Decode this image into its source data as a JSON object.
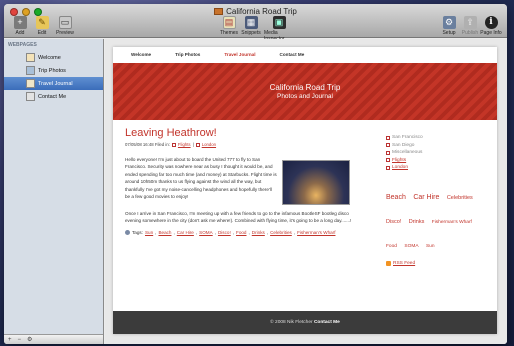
{
  "window": {
    "title": "California Road Trip"
  },
  "toolbar": {
    "left": [
      {
        "label": "Add"
      },
      {
        "label": "Edit"
      },
      {
        "label": "Preview"
      }
    ],
    "center": [
      {
        "label": "Themes"
      },
      {
        "label": "Snippets"
      },
      {
        "label": "Media Inspector"
      }
    ],
    "right": [
      {
        "label": "Setup"
      },
      {
        "label": "Publish"
      },
      {
        "label": "Page Info"
      }
    ]
  },
  "sidebar": {
    "heading": "WEBPAGES",
    "items": [
      {
        "label": "Welcome"
      },
      {
        "label": "Trip Photos"
      },
      {
        "label": "Travel Journal"
      },
      {
        "label": "Contact Me"
      }
    ]
  },
  "site": {
    "nav": [
      "Welcome",
      "Trip Photos",
      "Travel Journal",
      "Contact Me"
    ],
    "banner_title": "California Road Trip",
    "banner_subtitle": "Photos and Journal",
    "post_title": "Leaving Heathrow!",
    "post_date": "07/05/08 16:48 Filed in:",
    "post_filed": [
      "Flights",
      "London"
    ],
    "paragraph1": "Hello everyone! I'm just about to board the United 777 to fly to San Francisco. Security was nowhere near as busy I thought it would be, and ended spending far too much time (and money) at Starbucks. Flight time is around 10h50m thanks to us flying against the wind all the way, but thankfully I've got my noise-cancelling headphones and hopefully there'll be a few good movies to enjoy!",
    "paragraph2": "Once I arrive in San Francisco, I'm meeting up with a few friends to go to the infamous BootleSF bootleg disco evening somewhere in the city (don't ask me where!). Combined with flying time, it's going to be a long day.......!",
    "tags_label": "Tags:",
    "tags": [
      "Sun",
      "Beach",
      "Car Hire",
      "SOMA",
      "Disco!",
      "Food",
      "Drinks",
      "Celebrities",
      "Fisherman's Wharf"
    ],
    "side_links": [
      {
        "label": "San Francisco",
        "link": false
      },
      {
        "label": "San Diego",
        "link": false
      },
      {
        "label": "Miscellaneous",
        "link": false
      },
      {
        "label": "Flights",
        "link": true
      },
      {
        "label": "London",
        "link": true
      }
    ],
    "tag_cloud": [
      "Beach",
      "Car Hire",
      "Celebrities",
      "Disco!",
      "Drinks",
      "Fisherman's Wharf",
      "Food",
      "SOMA",
      "Sun"
    ],
    "rss_label": "RSS Feed",
    "footer_text": "© 2008 Nik Fletcher",
    "footer_link": "Contact Me"
  },
  "colors": {
    "accent": "#c2342b",
    "banner": "#c43527",
    "sidebar_selected": "#3b6dba",
    "footer": "#3b3b3b"
  }
}
